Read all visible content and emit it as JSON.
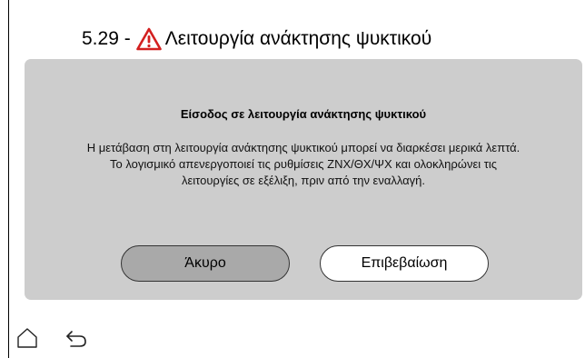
{
  "header": {
    "prefix": "5.29 -",
    "title": "Λειτουργία ανάκτησης ψυκτικού",
    "warning_color": "#d32020"
  },
  "dialog": {
    "title": "Είσοδος σε λειτουργία ανάκτησης ψυκτικού",
    "body_lines": [
      "Η μετάβαση στη λειτουργία ανάκτησης ψυκτικού μπορεί να διαρκέσει μερικά λεπτά.",
      "Το λογισμικό απενεργοποιεί τις ρυθμίσεις ΖΝΧ/ΘΧ/ΨΧ και ολοκληρώνει τις",
      "λειτουργίες σε εξέλιξη, πριν από την εναλλαγή."
    ],
    "cancel_label": "Άκυρο",
    "confirm_label": "Επιβεβαίωση"
  },
  "nav": {
    "home_icon": "home-icon",
    "back_icon": "back-arrow-icon"
  }
}
